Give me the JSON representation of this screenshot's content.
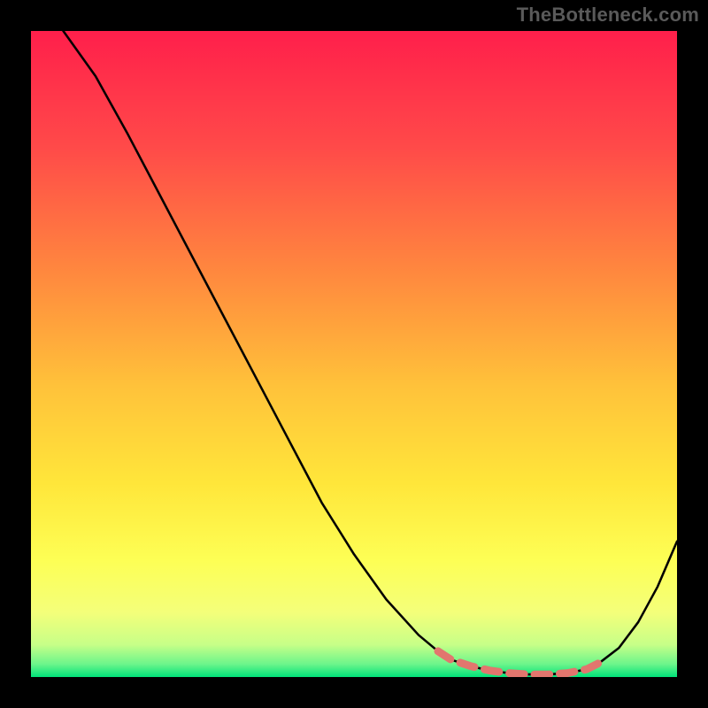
{
  "watermark": "TheBottleneck.com",
  "colors": {
    "gradient_stops": [
      {
        "offset": "0%",
        "color": "#ff1f4b"
      },
      {
        "offset": "18%",
        "color": "#ff4a49"
      },
      {
        "offset": "38%",
        "color": "#ff8a3e"
      },
      {
        "offset": "55%",
        "color": "#ffc23a"
      },
      {
        "offset": "70%",
        "color": "#ffe63a"
      },
      {
        "offset": "82%",
        "color": "#fdff55"
      },
      {
        "offset": "90%",
        "color": "#f4ff7a"
      },
      {
        "offset": "95%",
        "color": "#c7ff88"
      },
      {
        "offset": "98%",
        "color": "#6cf58b"
      },
      {
        "offset": "100%",
        "color": "#00e37a"
      }
    ],
    "curve_stroke": "#000000",
    "marker_stroke": "#e2766e",
    "page_background": "#000000"
  },
  "chart_data": {
    "type": "line",
    "title": "",
    "xlabel": "",
    "ylabel": "",
    "x_range": [
      0,
      100
    ],
    "y_range": [
      0,
      100
    ],
    "note": "x and y are normalized 0–100 across the plot area; y is bottleneck percentage (0 = no bottleneck at bottom, 100 = max at top). Source site shows no numeric axes.",
    "series": [
      {
        "name": "bottleneck_curve",
        "x": [
          5,
          10,
          15,
          20,
          25,
          30,
          35,
          40,
          45,
          50,
          55,
          60,
          63,
          65,
          68,
          71,
          74,
          77,
          80,
          83,
          86,
          88,
          91,
          94,
          97,
          100
        ],
        "y": [
          100,
          93,
          84,
          74.5,
          65,
          55.5,
          46,
          36.5,
          27,
          19,
          12,
          6.5,
          4,
          2.7,
          1.7,
          1.0,
          0.6,
          0.4,
          0.4,
          0.6,
          1.2,
          2.2,
          4.5,
          8.5,
          14,
          21
        ]
      }
    ],
    "optimal_band": {
      "description": "dashed pink segment near curve minimum indicating balanced / non-bottlenecked region",
      "x": [
        63,
        65,
        68,
        71,
        74,
        77,
        80,
        83,
        86,
        88
      ],
      "y": [
        4,
        2.7,
        1.7,
        1.0,
        0.6,
        0.4,
        0.4,
        0.6,
        1.2,
        2.2
      ]
    }
  }
}
